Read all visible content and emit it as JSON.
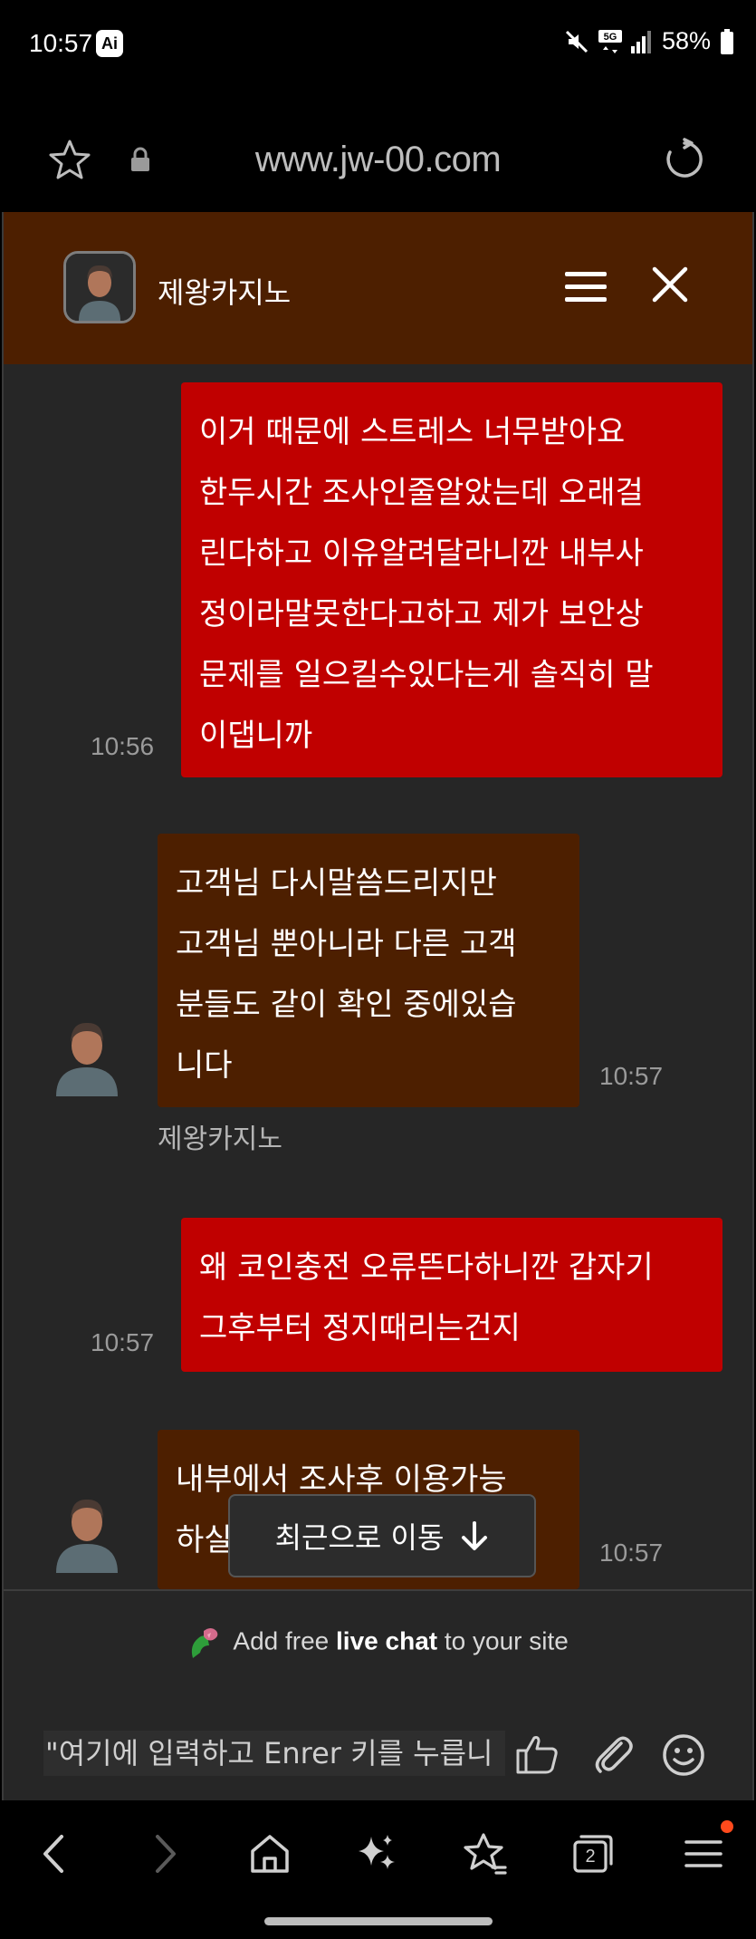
{
  "status_bar": {
    "time": "10:57",
    "ai_badge": "Ai",
    "network": "5G",
    "battery": "58%"
  },
  "browser": {
    "url": "www.jw-00.com",
    "tab_count": "2"
  },
  "chat": {
    "title": "제왕카지노",
    "messages": [
      {
        "from": "user",
        "lines": [
          "이거 때문에 스트레스 너무받아요",
          "한두시간 조사인줄알았는데 오래걸",
          "린다하고 이유알려달라니깐 내부사",
          "정이라말못한다고하고 제가 보안상",
          "문제를 일으킬수있다는게 솔직히 말",
          "이댑니까"
        ],
        "time": "10:56"
      },
      {
        "from": "agent",
        "lines": [
          "고객님 다시말씀드리지만",
          "고객님 뿐아니라 다른 고객",
          "분들도 같이 확인 중에있습",
          "니다"
        ],
        "time": "10:57",
        "name": "제왕카지노"
      },
      {
        "from": "user",
        "lines": [
          "왜 코인충전 오류뜬다하니깐 갑자기",
          "그후부터 정지때리는건지"
        ],
        "time": "10:57"
      },
      {
        "from": "agent",
        "lines": [
          "내부에서 조사후 이용가능",
          "하실"
        ],
        "time": "10:57"
      }
    ],
    "jump_label": "최근으로 이동",
    "footer": {
      "prefix": "Add free",
      "bold": "live chat",
      "suffix": "to your site"
    },
    "input_placeholder": "\"여기에 입력하고 Enrer 키를 누릅니"
  },
  "colors": {
    "header_bg": "#4d1f00",
    "user_bubble": "#c00000",
    "agent_bubble": "#4d1f00",
    "chat_bg": "#262626"
  }
}
